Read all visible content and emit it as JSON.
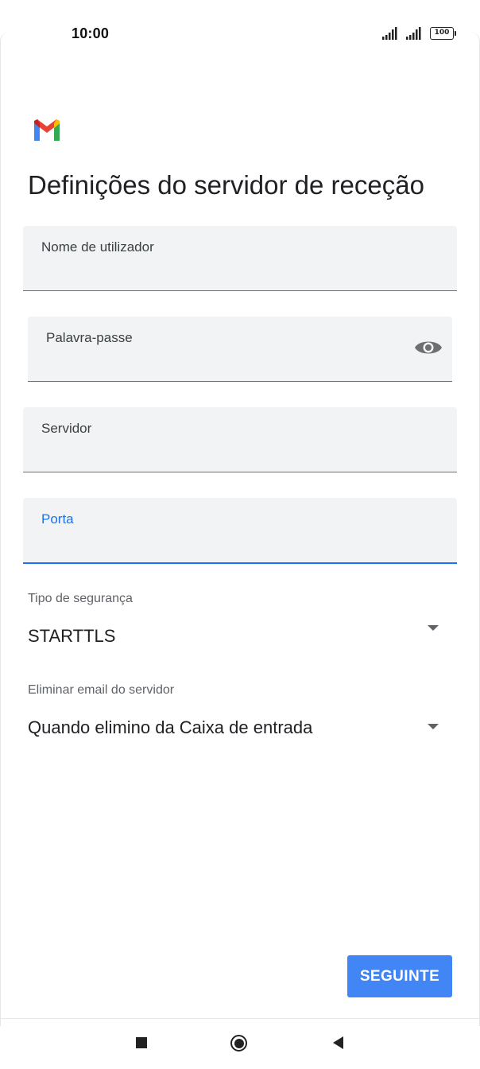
{
  "status_bar": {
    "time": "10:00",
    "signal_icons": [
      "signal-icon",
      "signal-icon"
    ],
    "battery": "100"
  },
  "app": {
    "logo_icon": "gmail-logo-icon"
  },
  "page": {
    "title": "Definições do servidor de receção"
  },
  "fields": {
    "username": {
      "label": "Nome de utilizador",
      "value": ""
    },
    "password": {
      "label": "Palavra-passe",
      "value": "",
      "toggle_icon": "eye-icon"
    },
    "server": {
      "label": "Servidor",
      "value": ""
    },
    "port": {
      "label": "Porta",
      "value": "",
      "focused": true
    }
  },
  "dropdowns": {
    "security_type": {
      "label": "Tipo de segurança",
      "value": "STARTTLS"
    },
    "delete_from_server": {
      "label": "Eliminar email do servidor",
      "value": "Quando elimino da Caixa de entrada"
    }
  },
  "actions": {
    "next_label": "SEGUINTE"
  },
  "colors": {
    "accent": "#1a73e8",
    "button": "#4285f4",
    "field_bg": "#f1f3f4"
  },
  "nav_bar": {
    "icons": [
      "recents-icon",
      "home-icon",
      "back-icon"
    ]
  }
}
